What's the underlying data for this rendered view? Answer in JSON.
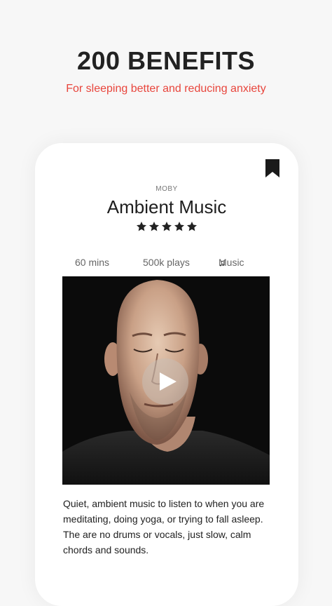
{
  "promo": {
    "headline": "200 BENEFITS",
    "subheadline": "For sleeping better and reducing anxiety"
  },
  "track": {
    "artist": "MOBY",
    "title": "Ambient Music",
    "rating": 5,
    "rating_max": 5,
    "duration": "60 mins",
    "plays": "500k plays",
    "genre": "Music",
    "genre_icon": "music-note-icon",
    "description": "Quiet, ambient music to listen to when you are meditating, doing yoga, or trying to fall asleep. The are no drums or vocals, just slow, calm chords and sounds."
  },
  "icons": {
    "bookmark": "bookmark-icon",
    "play": "play-icon",
    "star": "star-icon"
  },
  "colors": {
    "accent": "#e8453c",
    "text": "#222222",
    "background": "#f7f7f7"
  }
}
